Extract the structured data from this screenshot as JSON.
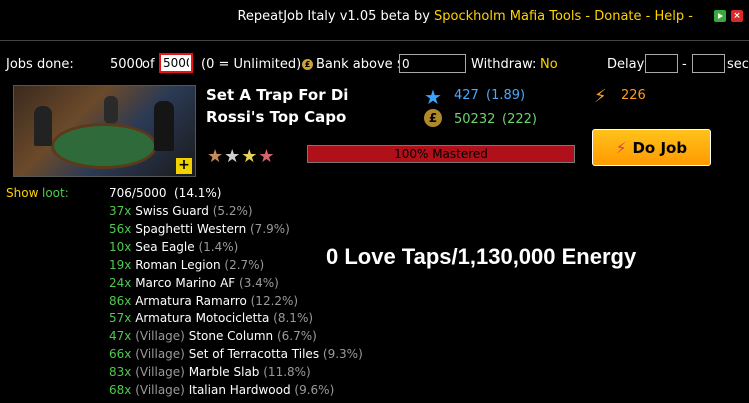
{
  "header": {
    "app_title": "RepeatJob Italy v1.05 beta",
    "by": "by",
    "author": "Spockholm Mafia Tools",
    "dash1": "-",
    "donate": "Donate",
    "dash2": "-",
    "help": "Help",
    "dash3": "-"
  },
  "controls": {
    "jobs_done_label": "Jobs done:",
    "jobs_done_value": "5000",
    "of_label": "of",
    "jobs_target": "5000",
    "unlimited_hint": "(0 = Unlimited)",
    "bank_label": "Bank above $",
    "bank_value": "0",
    "withdraw_label": "Withdraw:",
    "withdraw_value": "No",
    "delay_label": "Delay",
    "delay_dash": "-",
    "sec_label": "sec",
    "delay_min": "",
    "delay_max": ""
  },
  "job": {
    "title_line1": "Set A Trap For Di",
    "title_line2": "Rossi's Top Capo",
    "xp": "427",
    "xp_ratio": "(1.89)",
    "money": "50232",
    "money_ratio": "(222)",
    "energy": "226",
    "mastery_text": "100% Mastered",
    "mastery_fraction": 1.0,
    "do_job_label": "Do Job",
    "stars_filled": 3,
    "stars_total": 4
  },
  "loot": {
    "show_label": "Show",
    "loot_label": "loot:",
    "summary": "706/5000",
    "summary_pct": "(14.1%)",
    "items": [
      {
        "count": "37x",
        "village": "",
        "name": "Swiss Guard",
        "pct": "(5.2%)"
      },
      {
        "count": "56x",
        "village": "",
        "name": "Spaghetti Western",
        "pct": "(7.9%)"
      },
      {
        "count": "10x",
        "village": "",
        "name": "Sea Eagle",
        "pct": "(1.4%)"
      },
      {
        "count": "19x",
        "village": "",
        "name": "Roman Legion",
        "pct": "(2.7%)"
      },
      {
        "count": "24x",
        "village": "",
        "name": "Marco Marino AF",
        "pct": "(3.4%)"
      },
      {
        "count": "86x",
        "village": "",
        "name": "Armatura Ramarro",
        "pct": "(12.2%)"
      },
      {
        "count": "57x",
        "village": "",
        "name": "Armatura Motocicletta",
        "pct": "(8.1%)"
      },
      {
        "count": "47x",
        "village": "(Village)",
        "name": "Stone Column",
        "pct": "(6.7%)"
      },
      {
        "count": "66x",
        "village": "(Village)",
        "name": "Set of Terracotta Tiles",
        "pct": "(9.3%)"
      },
      {
        "count": "83x",
        "village": "(Village)",
        "name": "Marble Slab",
        "pct": "(11.8%)"
      },
      {
        "count": "68x",
        "village": "(Village)",
        "name": "Italian Hardwood",
        "pct": "(9.6%)"
      }
    ]
  },
  "overlay_text": "0 Love Taps/1,130,000 Energy"
}
